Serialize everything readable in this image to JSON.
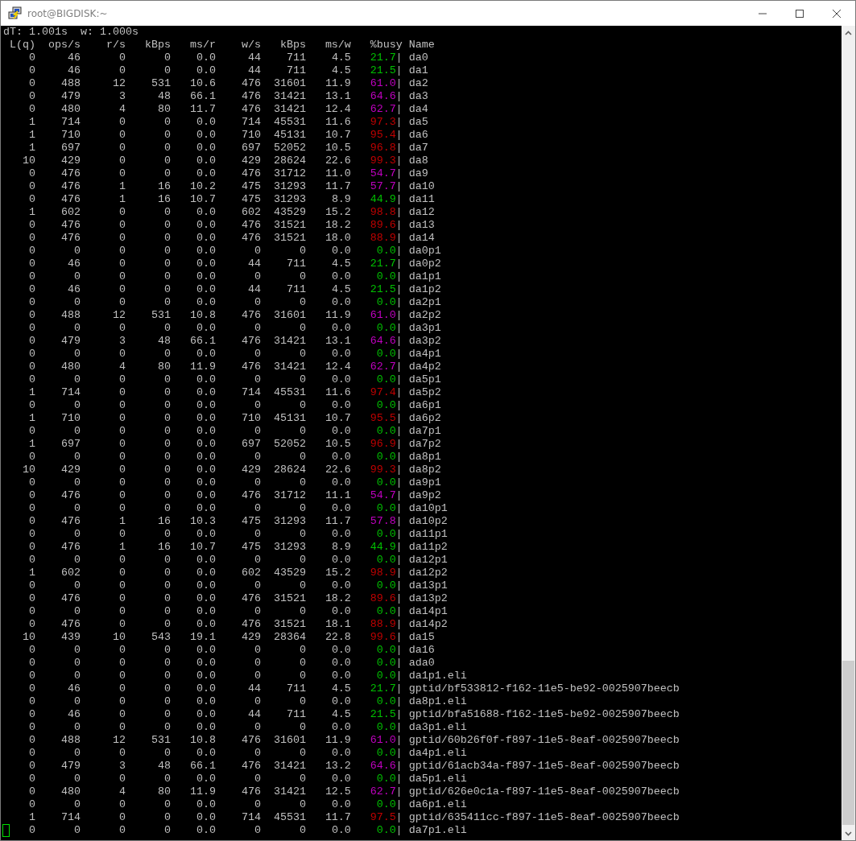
{
  "window": {
    "title": "root@BIGDISK:~"
  },
  "terminal": {
    "status": [
      "dT: 1.001s",
      "w: 1.000s"
    ],
    "columns": [
      "L(q)",
      "ops/s",
      "r/s",
      "kBps",
      "ms/r",
      "w/s",
      "kBps",
      "ms/w",
      "%busy",
      "Name"
    ],
    "cursor_visible": true,
    "rows": [
      {
        "cells": [
          "0",
          "46",
          "0",
          "0",
          "0.0",
          "44",
          "711",
          "4.5"
        ],
        "busy": "21.7",
        "color": "#00c000",
        "name": "da0"
      },
      {
        "cells": [
          "0",
          "46",
          "0",
          "0",
          "0.0",
          "44",
          "711",
          "4.5"
        ],
        "busy": "21.5",
        "color": "#00c000",
        "name": "da1"
      },
      {
        "cells": [
          "0",
          "488",
          "12",
          "531",
          "10.6",
          "476",
          "31601",
          "11.9"
        ],
        "busy": "61.0",
        "color": "#c000c0",
        "name": "da2"
      },
      {
        "cells": [
          "0",
          "479",
          "3",
          "48",
          "66.1",
          "476",
          "31421",
          "13.1"
        ],
        "busy": "64.6",
        "color": "#c000c0",
        "name": "da3"
      },
      {
        "cells": [
          "0",
          "480",
          "4",
          "80",
          "11.7",
          "476",
          "31421",
          "12.4"
        ],
        "busy": "62.7",
        "color": "#c000c0",
        "name": "da4"
      },
      {
        "cells": [
          "1",
          "714",
          "0",
          "0",
          "0.0",
          "714",
          "45531",
          "11.6"
        ],
        "busy": "97.3",
        "color": "#c00000",
        "name": "da5"
      },
      {
        "cells": [
          "1",
          "710",
          "0",
          "0",
          "0.0",
          "710",
          "45131",
          "10.7"
        ],
        "busy": "95.4",
        "color": "#c00000",
        "name": "da6"
      },
      {
        "cells": [
          "1",
          "697",
          "0",
          "0",
          "0.0",
          "697",
          "52052",
          "10.5"
        ],
        "busy": "96.8",
        "color": "#c00000",
        "name": "da7"
      },
      {
        "cells": [
          "10",
          "429",
          "0",
          "0",
          "0.0",
          "429",
          "28624",
          "22.6"
        ],
        "busy": "99.3",
        "color": "#c00000",
        "name": "da8"
      },
      {
        "cells": [
          "0",
          "476",
          "0",
          "0",
          "0.0",
          "476",
          "31712",
          "11.0"
        ],
        "busy": "54.7",
        "color": "#c000c0",
        "name": "da9"
      },
      {
        "cells": [
          "0",
          "476",
          "1",
          "16",
          "10.2",
          "475",
          "31293",
          "11.7"
        ],
        "busy": "57.7",
        "color": "#c000c0",
        "name": "da10"
      },
      {
        "cells": [
          "0",
          "476",
          "1",
          "16",
          "10.7",
          "475",
          "31293",
          "8.9"
        ],
        "busy": "44.9",
        "color": "#00c000",
        "name": "da11"
      },
      {
        "cells": [
          "1",
          "602",
          "0",
          "0",
          "0.0",
          "602",
          "43529",
          "15.2"
        ],
        "busy": "98.8",
        "color": "#c00000",
        "name": "da12"
      },
      {
        "cells": [
          "0",
          "476",
          "0",
          "0",
          "0.0",
          "476",
          "31521",
          "18.2"
        ],
        "busy": "89.6",
        "color": "#c00000",
        "name": "da13"
      },
      {
        "cells": [
          "0",
          "476",
          "0",
          "0",
          "0.0",
          "476",
          "31521",
          "18.0"
        ],
        "busy": "88.9",
        "color": "#c00000",
        "name": "da14"
      },
      {
        "cells": [
          "0",
          "0",
          "0",
          "0",
          "0.0",
          "0",
          "0",
          "0.0"
        ],
        "busy": "0.0",
        "color": "#00c000",
        "name": "da0p1"
      },
      {
        "cells": [
          "0",
          "46",
          "0",
          "0",
          "0.0",
          "44",
          "711",
          "4.5"
        ],
        "busy": "21.7",
        "color": "#00c000",
        "name": "da0p2"
      },
      {
        "cells": [
          "0",
          "0",
          "0",
          "0",
          "0.0",
          "0",
          "0",
          "0.0"
        ],
        "busy": "0.0",
        "color": "#00c000",
        "name": "da1p1"
      },
      {
        "cells": [
          "0",
          "46",
          "0",
          "0",
          "0.0",
          "44",
          "711",
          "4.5"
        ],
        "busy": "21.5",
        "color": "#00c000",
        "name": "da1p2"
      },
      {
        "cells": [
          "0",
          "0",
          "0",
          "0",
          "0.0",
          "0",
          "0",
          "0.0"
        ],
        "busy": "0.0",
        "color": "#00c000",
        "name": "da2p1"
      },
      {
        "cells": [
          "0",
          "488",
          "12",
          "531",
          "10.8",
          "476",
          "31601",
          "11.9"
        ],
        "busy": "61.0",
        "color": "#c000c0",
        "name": "da2p2"
      },
      {
        "cells": [
          "0",
          "0",
          "0",
          "0",
          "0.0",
          "0",
          "0",
          "0.0"
        ],
        "busy": "0.0",
        "color": "#00c000",
        "name": "da3p1"
      },
      {
        "cells": [
          "0",
          "479",
          "3",
          "48",
          "66.1",
          "476",
          "31421",
          "13.1"
        ],
        "busy": "64.6",
        "color": "#c000c0",
        "name": "da3p2"
      },
      {
        "cells": [
          "0",
          "0",
          "0",
          "0",
          "0.0",
          "0",
          "0",
          "0.0"
        ],
        "busy": "0.0",
        "color": "#00c000",
        "name": "da4p1"
      },
      {
        "cells": [
          "0",
          "480",
          "4",
          "80",
          "11.9",
          "476",
          "31421",
          "12.4"
        ],
        "busy": "62.7",
        "color": "#c000c0",
        "name": "da4p2"
      },
      {
        "cells": [
          "0",
          "0",
          "0",
          "0",
          "0.0",
          "0",
          "0",
          "0.0"
        ],
        "busy": "0.0",
        "color": "#00c000",
        "name": "da5p1"
      },
      {
        "cells": [
          "1",
          "714",
          "0",
          "0",
          "0.0",
          "714",
          "45531",
          "11.6"
        ],
        "busy": "97.4",
        "color": "#c00000",
        "name": "da5p2"
      },
      {
        "cells": [
          "0",
          "0",
          "0",
          "0",
          "0.0",
          "0",
          "0",
          "0.0"
        ],
        "busy": "0.0",
        "color": "#00c000",
        "name": "da6p1"
      },
      {
        "cells": [
          "1",
          "710",
          "0",
          "0",
          "0.0",
          "710",
          "45131",
          "10.7"
        ],
        "busy": "95.5",
        "color": "#c00000",
        "name": "da6p2"
      },
      {
        "cells": [
          "0",
          "0",
          "0",
          "0",
          "0.0",
          "0",
          "0",
          "0.0"
        ],
        "busy": "0.0",
        "color": "#00c000",
        "name": "da7p1"
      },
      {
        "cells": [
          "1",
          "697",
          "0",
          "0",
          "0.0",
          "697",
          "52052",
          "10.5"
        ],
        "busy": "96.9",
        "color": "#c00000",
        "name": "da7p2"
      },
      {
        "cells": [
          "0",
          "0",
          "0",
          "0",
          "0.0",
          "0",
          "0",
          "0.0"
        ],
        "busy": "0.0",
        "color": "#00c000",
        "name": "da8p1"
      },
      {
        "cells": [
          "10",
          "429",
          "0",
          "0",
          "0.0",
          "429",
          "28624",
          "22.6"
        ],
        "busy": "99.3",
        "color": "#c00000",
        "name": "da8p2"
      },
      {
        "cells": [
          "0",
          "0",
          "0",
          "0",
          "0.0",
          "0",
          "0",
          "0.0"
        ],
        "busy": "0.0",
        "color": "#00c000",
        "name": "da9p1"
      },
      {
        "cells": [
          "0",
          "476",
          "0",
          "0",
          "0.0",
          "476",
          "31712",
          "11.1"
        ],
        "busy": "54.7",
        "color": "#c000c0",
        "name": "da9p2"
      },
      {
        "cells": [
          "0",
          "0",
          "0",
          "0",
          "0.0",
          "0",
          "0",
          "0.0"
        ],
        "busy": "0.0",
        "color": "#00c000",
        "name": "da10p1"
      },
      {
        "cells": [
          "0",
          "476",
          "1",
          "16",
          "10.3",
          "475",
          "31293",
          "11.7"
        ],
        "busy": "57.8",
        "color": "#c000c0",
        "name": "da10p2"
      },
      {
        "cells": [
          "0",
          "0",
          "0",
          "0",
          "0.0",
          "0",
          "0",
          "0.0"
        ],
        "busy": "0.0",
        "color": "#00c000",
        "name": "da11p1"
      },
      {
        "cells": [
          "0",
          "476",
          "1",
          "16",
          "10.7",
          "475",
          "31293",
          "8.9"
        ],
        "busy": "44.9",
        "color": "#00c000",
        "name": "da11p2"
      },
      {
        "cells": [
          "0",
          "0",
          "0",
          "0",
          "0.0",
          "0",
          "0",
          "0.0"
        ],
        "busy": "0.0",
        "color": "#00c000",
        "name": "da12p1"
      },
      {
        "cells": [
          "1",
          "602",
          "0",
          "0",
          "0.0",
          "602",
          "43529",
          "15.2"
        ],
        "busy": "98.9",
        "color": "#c00000",
        "name": "da12p2"
      },
      {
        "cells": [
          "0",
          "0",
          "0",
          "0",
          "0.0",
          "0",
          "0",
          "0.0"
        ],
        "busy": "0.0",
        "color": "#00c000",
        "name": "da13p1"
      },
      {
        "cells": [
          "0",
          "476",
          "0",
          "0",
          "0.0",
          "476",
          "31521",
          "18.2"
        ],
        "busy": "89.6",
        "color": "#c00000",
        "name": "da13p2"
      },
      {
        "cells": [
          "0",
          "0",
          "0",
          "0",
          "0.0",
          "0",
          "0",
          "0.0"
        ],
        "busy": "0.0",
        "color": "#00c000",
        "name": "da14p1"
      },
      {
        "cells": [
          "0",
          "476",
          "0",
          "0",
          "0.0",
          "476",
          "31521",
          "18.1"
        ],
        "busy": "88.9",
        "color": "#c00000",
        "name": "da14p2"
      },
      {
        "cells": [
          "10",
          "439",
          "10",
          "543",
          "19.1",
          "429",
          "28364",
          "22.8"
        ],
        "busy": "99.6",
        "color": "#c00000",
        "name": "da15"
      },
      {
        "cells": [
          "0",
          "0",
          "0",
          "0",
          "0.0",
          "0",
          "0",
          "0.0"
        ],
        "busy": "0.0",
        "color": "#00c000",
        "name": "da16"
      },
      {
        "cells": [
          "0",
          "0",
          "0",
          "0",
          "0.0",
          "0",
          "0",
          "0.0"
        ],
        "busy": "0.0",
        "color": "#00c000",
        "name": "ada0"
      },
      {
        "cells": [
          "0",
          "0",
          "0",
          "0",
          "0.0",
          "0",
          "0",
          "0.0"
        ],
        "busy": "0.0",
        "color": "#00c000",
        "name": "da1p1.eli"
      },
      {
        "cells": [
          "0",
          "46",
          "0",
          "0",
          "0.0",
          "44",
          "711",
          "4.5"
        ],
        "busy": "21.7",
        "color": "#00c000",
        "name": "gptid/bf533812-f162-11e5-be92-0025907beecb"
      },
      {
        "cells": [
          "0",
          "0",
          "0",
          "0",
          "0.0",
          "0",
          "0",
          "0.0"
        ],
        "busy": "0.0",
        "color": "#00c000",
        "name": "da8p1.eli"
      },
      {
        "cells": [
          "0",
          "46",
          "0",
          "0",
          "0.0",
          "44",
          "711",
          "4.5"
        ],
        "busy": "21.5",
        "color": "#00c000",
        "name": "gptid/bfa51688-f162-11e5-be92-0025907beecb"
      },
      {
        "cells": [
          "0",
          "0",
          "0",
          "0",
          "0.0",
          "0",
          "0",
          "0.0"
        ],
        "busy": "0.0",
        "color": "#00c000",
        "name": "da3p1.eli"
      },
      {
        "cells": [
          "0",
          "488",
          "12",
          "531",
          "10.8",
          "476",
          "31601",
          "11.9"
        ],
        "busy": "61.0",
        "color": "#c000c0",
        "name": "gptid/60b26f0f-f897-11e5-8eaf-0025907beecb"
      },
      {
        "cells": [
          "0",
          "0",
          "0",
          "0",
          "0.0",
          "0",
          "0",
          "0.0"
        ],
        "busy": "0.0",
        "color": "#00c000",
        "name": "da4p1.eli"
      },
      {
        "cells": [
          "0",
          "479",
          "3",
          "48",
          "66.1",
          "476",
          "31421",
          "13.2"
        ],
        "busy": "64.6",
        "color": "#c000c0",
        "name": "gptid/61acb34a-f897-11e5-8eaf-0025907beecb"
      },
      {
        "cells": [
          "0",
          "0",
          "0",
          "0",
          "0.0",
          "0",
          "0",
          "0.0"
        ],
        "busy": "0.0",
        "color": "#00c000",
        "name": "da5p1.eli"
      },
      {
        "cells": [
          "0",
          "480",
          "4",
          "80",
          "11.9",
          "476",
          "31421",
          "12.5"
        ],
        "busy": "62.7",
        "color": "#c000c0",
        "name": "gptid/626e0c1a-f897-11e5-8eaf-0025907beecb"
      },
      {
        "cells": [
          "0",
          "0",
          "0",
          "0",
          "0.0",
          "0",
          "0",
          "0.0"
        ],
        "busy": "0.0",
        "color": "#00c000",
        "name": "da6p1.eli"
      },
      {
        "cells": [
          "1",
          "714",
          "0",
          "0",
          "0.0",
          "714",
          "45531",
          "11.7"
        ],
        "busy": "97.5",
        "color": "#c00000",
        "name": "gptid/635411cc-f897-11e5-8eaf-0025907beecb"
      },
      {
        "cells": [
          "0",
          "0",
          "0",
          "0",
          "0.0",
          "0",
          "0",
          "0.0"
        ],
        "busy": "0.0",
        "color": "#00c000",
        "name": "da7p1.eli"
      }
    ]
  }
}
